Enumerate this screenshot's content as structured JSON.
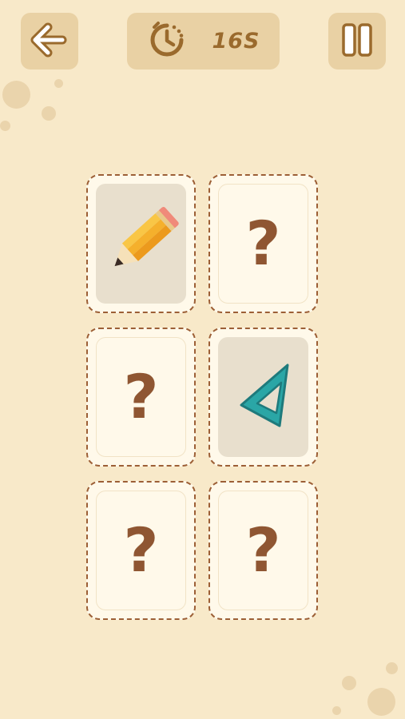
{
  "timer": {
    "value": "16S"
  },
  "icons": {
    "back": "arrow-left-icon",
    "timer": "stopwatch-icon",
    "pause": "pause-icon",
    "pencil": "pencil-icon",
    "set_square": "set-square-icon"
  },
  "cards": [
    {
      "state": "revealed",
      "item": "pencil-icon"
    },
    {
      "state": "hidden",
      "label": "?"
    },
    {
      "state": "hidden",
      "label": "?"
    },
    {
      "state": "revealed",
      "item": "set-square-icon"
    },
    {
      "state": "hidden",
      "label": "?"
    },
    {
      "state": "hidden",
      "label": "?"
    }
  ],
  "colors": {
    "background": "#f8e9c9",
    "button": "#e9d1a4",
    "accent_brown": "#8f5632",
    "card_border": "#9c5f36"
  }
}
